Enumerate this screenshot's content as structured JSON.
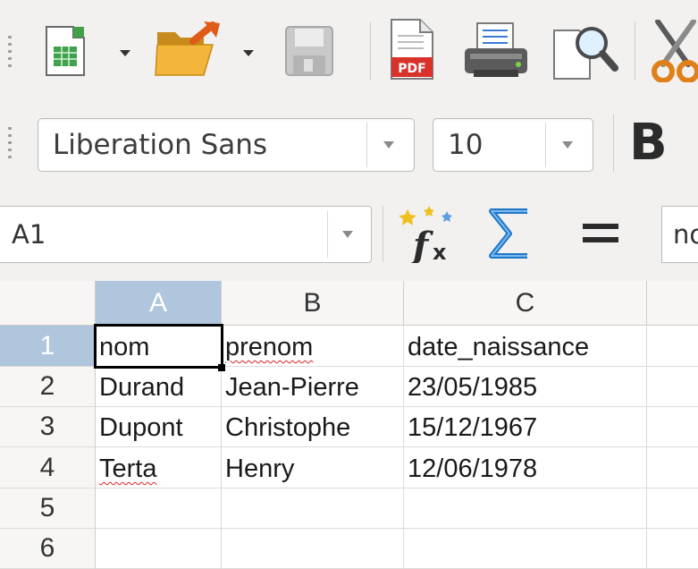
{
  "toolbar": {
    "icons": [
      "spreadsheet-new-icon",
      "open-folder-icon",
      "save-icon",
      "export-pdf-icon",
      "print-icon",
      "print-preview-icon",
      "cut-icon"
    ]
  },
  "font_toolbar": {
    "font_name": "Liberation Sans",
    "font_size": "10",
    "bold_label": "B"
  },
  "formula_bar": {
    "name_box": "A1",
    "formula_input": "nom"
  },
  "sheet": {
    "columns": [
      "A",
      "B",
      "C"
    ],
    "rows": [
      "1",
      "2",
      "3",
      "4",
      "5",
      "6"
    ],
    "cells": [
      [
        "nom",
        "prenom",
        "date_naissance"
      ],
      [
        "Durand",
        "Jean-Pierre",
        "23/05/1985"
      ],
      [
        "Dupont",
        "Christophe",
        "15/12/1967"
      ],
      [
        "Terta",
        "Henry",
        "12/06/1978"
      ],
      [
        "",
        "",
        ""
      ],
      [
        "",
        "",
        ""
      ]
    ],
    "selected_cell": "A1"
  },
  "colors": {
    "toolbar_bg": "#f2f1f0",
    "header_selected": "#afc6dd",
    "spellcheck": "#e02020"
  }
}
